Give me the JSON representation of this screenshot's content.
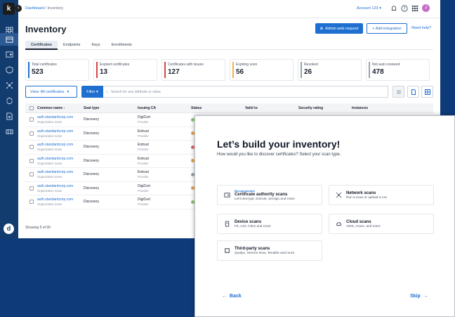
{
  "rail": {
    "logo": "k",
    "avatar": "d",
    "items": [
      {
        "icon": "dashboard-icon"
      },
      {
        "icon": "inventory-icon"
      },
      {
        "icon": "certificate-icon"
      },
      {
        "icon": "shield-icon"
      },
      {
        "icon": "network-icon"
      },
      {
        "icon": "cycle-icon"
      },
      {
        "icon": "document-icon"
      },
      {
        "icon": "integrations-icon"
      }
    ]
  },
  "topbar": {
    "breadcrumb_root": "Dashboard",
    "breadcrumb_sep": " / ",
    "breadcrumb_current": "Inventory",
    "account": "Account 123",
    "avatar": "J"
  },
  "header": {
    "title": "Inventory",
    "admin_button": "Admin web request",
    "integration_button": "+ Add integration",
    "help": "Need help?"
  },
  "tabs": [
    "Certificates",
    "Endpoints",
    "Keys",
    "Enrollments"
  ],
  "cards": [
    {
      "label": "Total certificates",
      "value": "523",
      "color": "#1f6fd1"
    },
    {
      "label": "Expired certificates",
      "value": "13",
      "color": "#d64545"
    },
    {
      "label": "Certificates with issues",
      "value": "127",
      "color": "#d64545"
    },
    {
      "label": "Expiring soon",
      "value": "56",
      "color": "#f0b43c"
    },
    {
      "label": "Revoked",
      "value": "26",
      "color": "#9aa3ae"
    },
    {
      "label": "Not auto renewed",
      "value": "478",
      "color": "#9aa3ae"
    }
  ],
  "toolbar": {
    "view": "View: All certificates",
    "filter": "Filter",
    "search_placeholder": "Search for any attribute or value"
  },
  "table": {
    "headers": [
      "Common name",
      "Seat type",
      "Issuing CA",
      "Status",
      "Valid to",
      "Security rating",
      "Instances"
    ],
    "rows": [
      {
        "name": "auth.standardcorp.com",
        "org": "Organization name",
        "seat": "Discovery",
        "ca": "DigiCert",
        "ca_sub": "Provider",
        "status": "#8fc36b"
      },
      {
        "name": "auth.standardcorp.com",
        "org": "Organization name",
        "seat": "Discovery",
        "ca": "Entrust",
        "ca_sub": "Provider",
        "status": "#e8a24a"
      },
      {
        "name": "auth.standardcorp.com",
        "org": "Organization name",
        "seat": "Discovery",
        "ca": "Entrust",
        "ca_sub": "Provider",
        "status": "#e06666"
      },
      {
        "name": "auth.standardcorp.com",
        "org": "Organization name",
        "seat": "Discovery",
        "ca": "Entrust",
        "ca_sub": "Provider",
        "status": "#e8a24a"
      },
      {
        "name": "auth.standardcorp.com",
        "org": "Organization name",
        "seat": "Discovery",
        "ca": "Entrust",
        "ca_sub": "Provider",
        "status": "#9aa3ae"
      },
      {
        "name": "auth.standardcorp.com",
        "org": "Organization name",
        "seat": "Discovery",
        "ca": "DigiCert",
        "ca_sub": "Provider",
        "status": "#e8a24a"
      },
      {
        "name": "auth.standardcorp.com",
        "org": "Organization name",
        "seat": "Discovery",
        "ca": "DigiCert",
        "ca_sub": "Provider",
        "status": "#8fc36b"
      }
    ]
  },
  "showing": "Showing 5 of 90",
  "modal": {
    "title": "Let’s build your inventory!",
    "subtitle": "How would you like to discover certificates? Select your scan type.",
    "options": [
      {
        "badge": "Recommended",
        "title": "Certificate authority scans",
        "desc": "Let's Encrypt, Entrust, Sectigo and more",
        "icon": "certificate-icon"
      },
      {
        "badge": "",
        "title": "Network scans",
        "desc": "Run a scan or upload a csv",
        "icon": "network-icon"
      },
      {
        "badge": "",
        "title": "Device scans",
        "desc": "F5, A10, Citrix and more",
        "icon": "device-icon"
      },
      {
        "badge": "",
        "title": "Cloud scans",
        "desc": "AWS, Azure, and more",
        "icon": "cloud-icon"
      },
      {
        "badge": "",
        "title": "Third-party scans",
        "desc": "Qualys, Service Now, Tenable and more",
        "icon": "third-party-icon"
      }
    ],
    "back": "Back",
    "skip": "Skip"
  }
}
